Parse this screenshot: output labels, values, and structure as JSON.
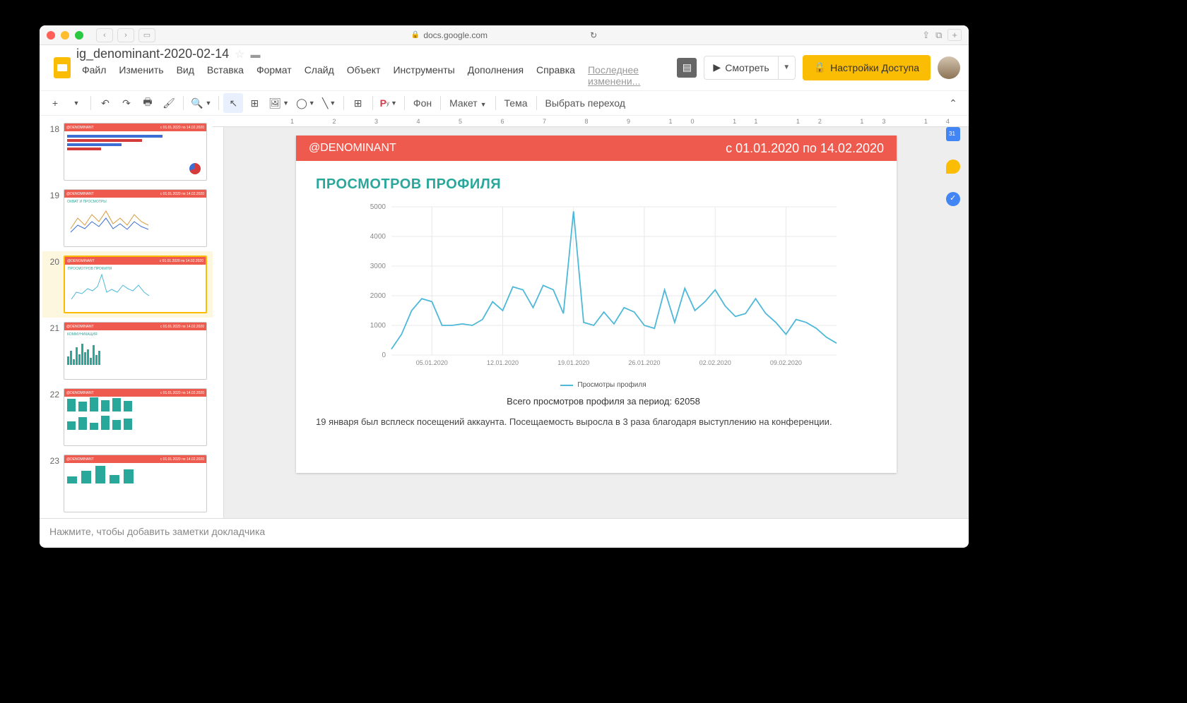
{
  "browser": {
    "url": "docs.google.com"
  },
  "doc": {
    "title": "ig_denominant-2020-02-14",
    "last_change": "Последнее изменени..."
  },
  "menu": {
    "file": "Файл",
    "edit": "Изменить",
    "view": "Вид",
    "insert": "Вставка",
    "format": "Формат",
    "slide": "Слайд",
    "object": "Объект",
    "tools": "Инструменты",
    "addons": "Дополнения",
    "help": "Справка"
  },
  "buttons": {
    "present": "Смотреть",
    "share": "Настройки Доступа"
  },
  "toolbar": {
    "background": "Фон",
    "layout": "Макет",
    "theme": "Тема",
    "transition": "Выбрать переход"
  },
  "filmstrip": {
    "numbers": [
      "18",
      "19",
      "20",
      "21",
      "22",
      "23"
    ],
    "thumb_handle": "@DENOMINANT",
    "thumb_date": "с 01.01.2020 по 14.02.2020",
    "titles": {
      "t19": "ОХВАТ И ПРОСМОТРЫ",
      "t20": "ПРОСМОТРОВ ПРОФИЛЯ",
      "t21": "КОММУНИКАЦИЯ"
    }
  },
  "slide": {
    "handle": "@DENOMINANT",
    "daterange": "с 01.01.2020 по 14.02.2020",
    "title": "ПРОСМОТРОВ ПРОФИЛЯ",
    "legend": "Просмотры профиля",
    "summary": "Всего просмотров профиля за период: 62058",
    "note": "19 января был всплеск посещений аккаунта. Посещаемость выросла в 3 раза благодаря выступлению на конференции."
  },
  "notes": {
    "placeholder": "Нажмите, чтобы добавить заметки докладчика"
  },
  "chart_data": {
    "type": "line",
    "title": "ПРОСМОТРОВ ПРОФИЛЯ",
    "xlabel": "",
    "ylabel": "",
    "ylim": [
      0,
      5000
    ],
    "y_ticks": [
      0,
      1000,
      2000,
      3000,
      4000,
      5000
    ],
    "x_tick_labels": [
      "05.01.2020",
      "12.01.2020",
      "19.01.2020",
      "26.01.2020",
      "02.02.2020",
      "09.02.2020"
    ],
    "series": [
      {
        "name": "Просмотры профиля",
        "color": "#4db8d8",
        "x": [
          "01.01.2020",
          "02.01.2020",
          "03.01.2020",
          "04.01.2020",
          "05.01.2020",
          "06.01.2020",
          "07.01.2020",
          "08.01.2020",
          "09.01.2020",
          "10.01.2020",
          "11.01.2020",
          "12.01.2020",
          "13.01.2020",
          "14.01.2020",
          "15.01.2020",
          "16.01.2020",
          "17.01.2020",
          "18.01.2020",
          "19.01.2020",
          "20.01.2020",
          "21.01.2020",
          "22.01.2020",
          "23.01.2020",
          "24.01.2020",
          "25.01.2020",
          "26.01.2020",
          "27.01.2020",
          "28.01.2020",
          "29.01.2020",
          "30.01.2020",
          "31.01.2020",
          "01.02.2020",
          "02.02.2020",
          "03.02.2020",
          "04.02.2020",
          "05.02.2020",
          "06.02.2020",
          "07.02.2020",
          "08.02.2020",
          "09.02.2020",
          "10.02.2020",
          "11.02.2020",
          "12.02.2020",
          "13.02.2020",
          "14.02.2020"
        ],
        "values": [
          200,
          700,
          1500,
          1900,
          1800,
          1000,
          1000,
          1050,
          1000,
          1200,
          1800,
          1500,
          2300,
          2200,
          1600,
          2350,
          2200,
          1400,
          4850,
          1100,
          1000,
          1450,
          1050,
          1600,
          1450,
          1000,
          900,
          2200,
          1100,
          2250,
          1500,
          1800,
          2200,
          1650,
          1300,
          1400,
          1900,
          1400,
          1100,
          700,
          1200,
          1100,
          900,
          600,
          400
        ]
      }
    ],
    "total": 62058
  }
}
